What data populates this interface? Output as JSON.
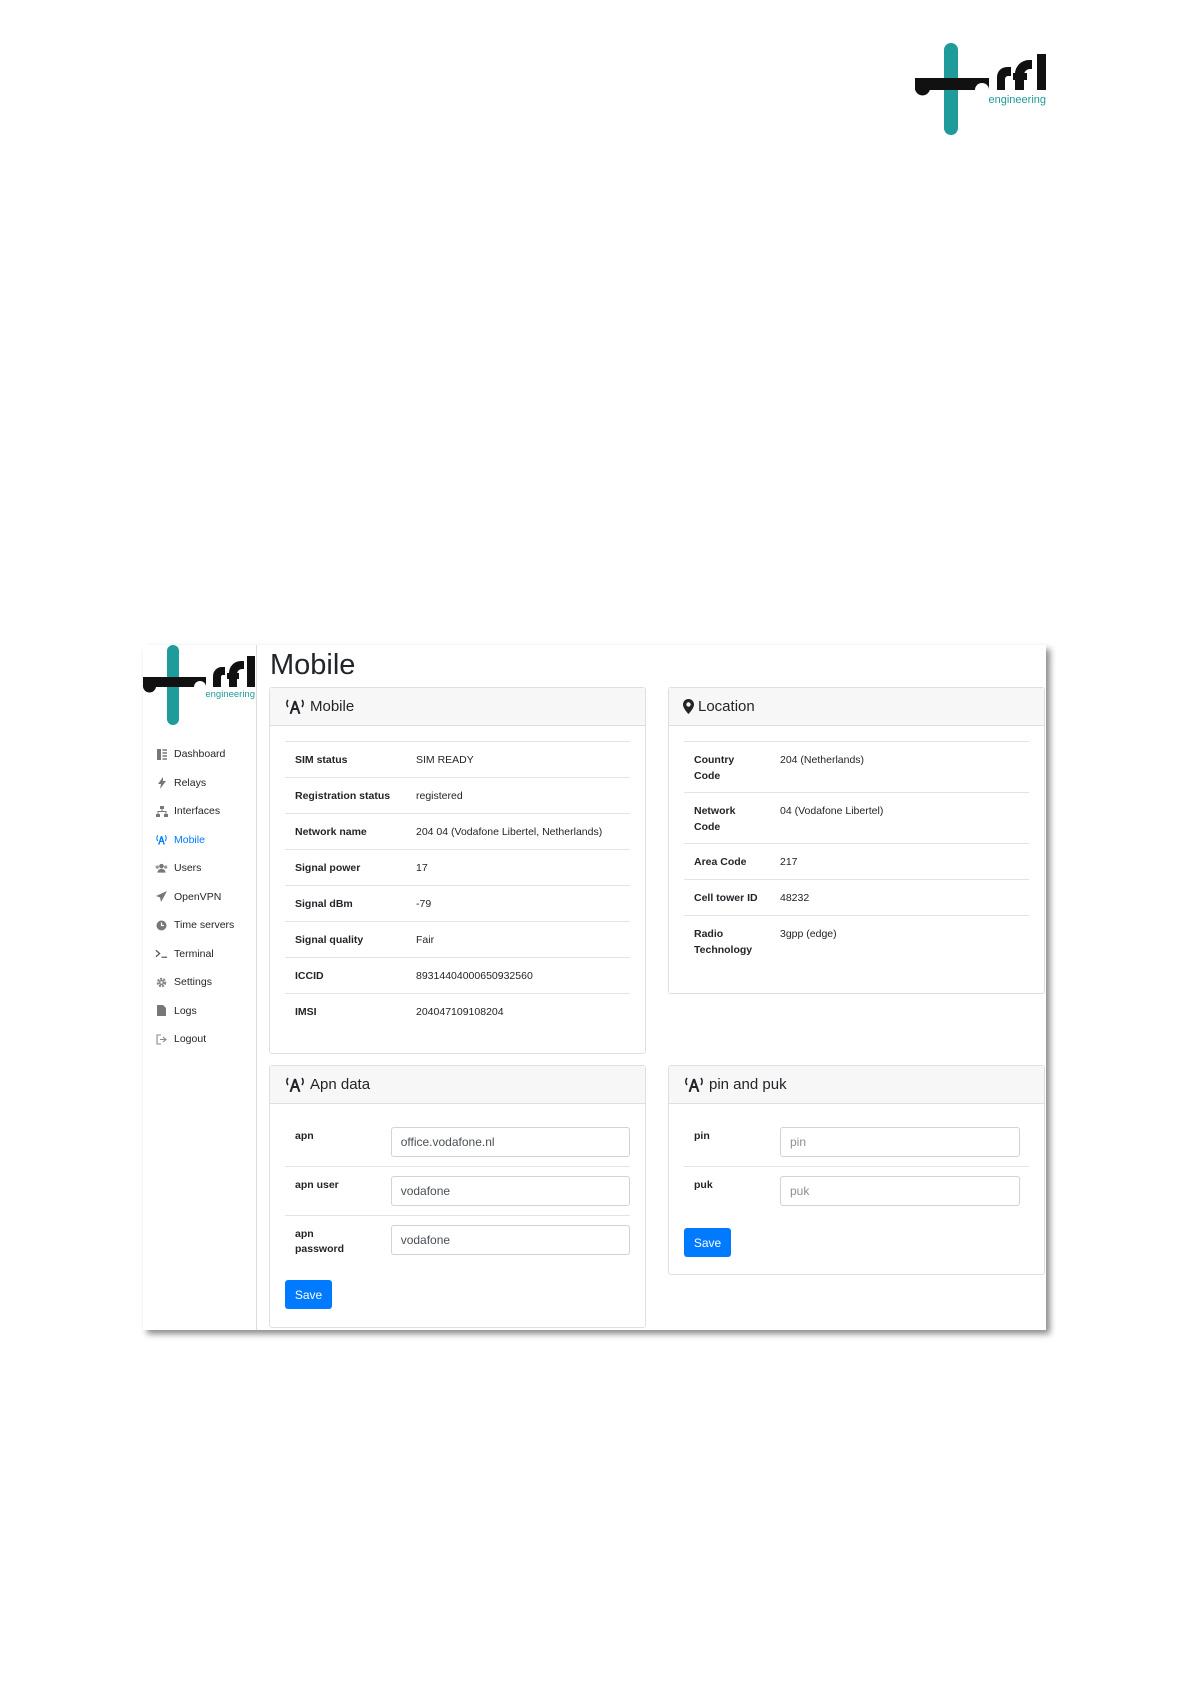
{
  "brand": {
    "name": "rfi",
    "tagline": "engineering"
  },
  "page": {
    "title": "Mobile"
  },
  "sidebar": {
    "items": [
      {
        "label": "Dashboard",
        "icon": "dashboard-icon"
      },
      {
        "label": "Relays",
        "icon": "bolt-icon"
      },
      {
        "label": "Interfaces",
        "icon": "network-icon"
      },
      {
        "label": "Mobile",
        "icon": "antenna-icon",
        "active": true
      },
      {
        "label": "Users",
        "icon": "users-icon"
      },
      {
        "label": "OpenVPN",
        "icon": "paper-plane-icon"
      },
      {
        "label": "Time servers",
        "icon": "clock-icon"
      },
      {
        "label": "Terminal",
        "icon": "terminal-icon"
      },
      {
        "label": "Settings",
        "icon": "gear-icon"
      },
      {
        "label": "Logs",
        "icon": "file-icon"
      },
      {
        "label": "Logout",
        "icon": "logout-icon"
      }
    ]
  },
  "mobile_card": {
    "title": "Mobile",
    "rows": [
      {
        "key": "SIM status",
        "value": "SIM READY"
      },
      {
        "key": "Registration status",
        "value": "registered"
      },
      {
        "key": "Network name",
        "value": "204 04 (Vodafone Libertel, Netherlands)"
      },
      {
        "key": "Signal power",
        "value": "17"
      },
      {
        "key": "Signal dBm",
        "value": "-79"
      },
      {
        "key": "Signal quality",
        "value": "Fair"
      },
      {
        "key": "ICCID",
        "value": "89314404000650932560"
      },
      {
        "key": "IMSI",
        "value": "204047109108204"
      }
    ]
  },
  "location_card": {
    "title": "Location",
    "rows": [
      {
        "key1": "Country",
        "key2": "Code",
        "value": "204 (Netherlands)"
      },
      {
        "key1": "Network",
        "key2": "Code",
        "value": "04 (Vodafone Libertel)"
      },
      {
        "key1": "Area Code",
        "key2": "",
        "value": "217"
      },
      {
        "key1": "Cell tower ID",
        "key2": "",
        "value": "48232"
      },
      {
        "key1": "Radio",
        "key2": "Technology",
        "value": "3gpp (edge)"
      }
    ]
  },
  "apn_card": {
    "title": "Apn data",
    "fields": [
      {
        "label1": "apn",
        "label2": "",
        "value": "office.vodafone.nl",
        "placeholder": ""
      },
      {
        "label1": "apn user",
        "label2": "",
        "value": "vodafone",
        "placeholder": ""
      },
      {
        "label1": "apn",
        "label2": "password",
        "value": "vodafone",
        "placeholder": ""
      }
    ],
    "save_label": "Save"
  },
  "pin_card": {
    "title": "pin and puk",
    "fields": [
      {
        "label": "pin",
        "value": "",
        "placeholder": "pin"
      },
      {
        "label": "puk",
        "value": "",
        "placeholder": "puk"
      }
    ],
    "save_label": "Save"
  },
  "colors": {
    "accent": "#007bff",
    "brand_teal": "#1e9b9a",
    "brand_dark": "#111111"
  }
}
